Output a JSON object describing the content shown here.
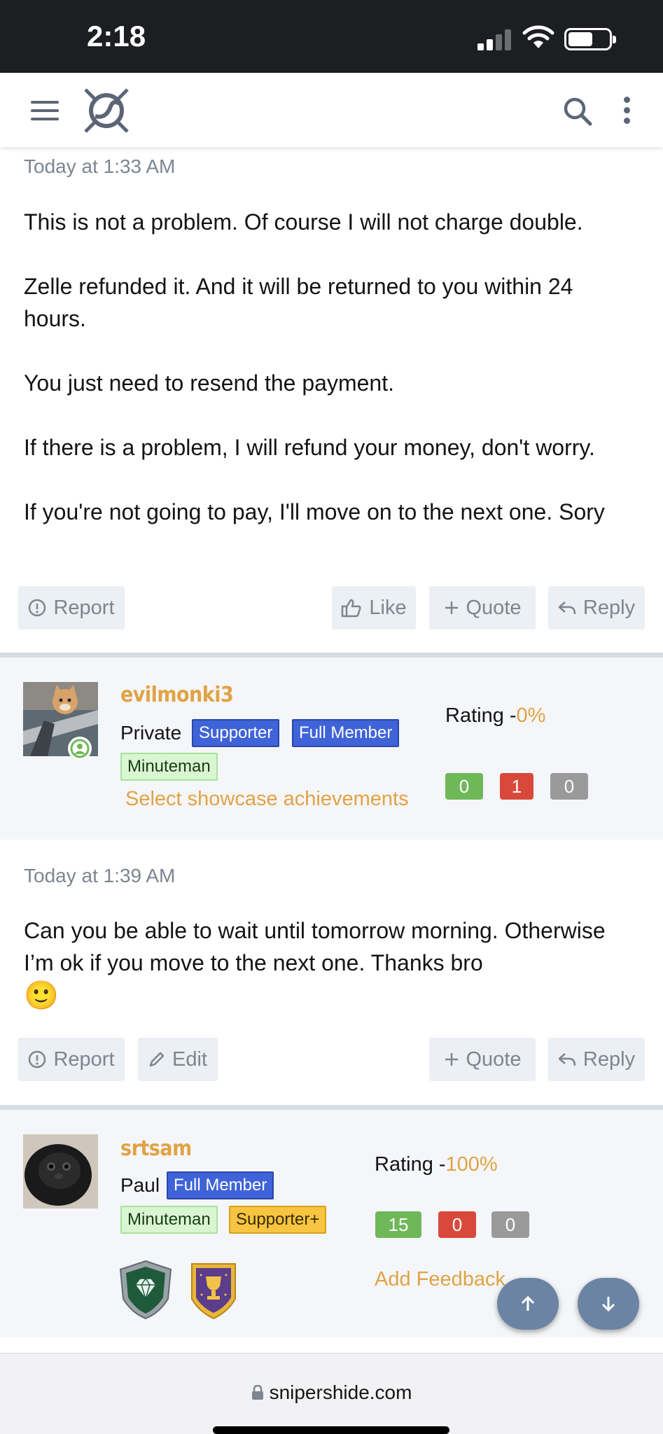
{
  "status_bar": {
    "time": "2:18"
  },
  "browser": {
    "url": "snipershide.com"
  },
  "posts": [
    {
      "timestamp": "Today at 1:33 AM",
      "paragraphs": [
        "This is not a problem. Of course I will not charge double.",
        "Zelle refunded it. And it will be returned to you within 24 hours.",
        "You just need to resend the payment.",
        "If there is a problem, I will refund your money, don't worry.",
        "If you're not going to pay, I'll move on to the next one. Sory"
      ],
      "actions": {
        "report": "Report",
        "like": "Like",
        "quote": "Quote",
        "reply": "Reply"
      }
    },
    {
      "timestamp": "Today at 1:39 AM",
      "paragraphs": [
        "Can you be able to wait until tomorrow morning. Otherwise I’m ok if you move to the next one. Thanks bro"
      ],
      "emoji": "🙂",
      "actions": {
        "report": "Report",
        "edit": "Edit",
        "quote": "Quote",
        "reply": "Reply"
      }
    }
  ],
  "authors": [
    {
      "username": "evilmonki3",
      "rank": "Private",
      "badges": [
        "Supporter",
        "Full Member",
        "Minuteman"
      ],
      "showcase_link": "Select showcase achievements",
      "rating_label": "Rating -",
      "rating_value": "0%",
      "counts": {
        "positive": "0",
        "negative": "1",
        "neutral": "0"
      }
    },
    {
      "username": "srtsam",
      "rank": "Paul",
      "badges": [
        "Full Member",
        "Minuteman",
        "Supporter+"
      ],
      "feedback_link": "Add Feedback",
      "rating_label": "Rating -",
      "rating_value": "100%",
      "counts": {
        "positive": "15",
        "negative": "0",
        "neutral": "0"
      }
    }
  ],
  "colors": {
    "accent_gold": "#e0a345",
    "badge_blue": "#3f63d8",
    "badge_green": "#d8f6d2",
    "badge_yellow": "#f7c541",
    "count_green": "#6fb85a",
    "count_red": "#d9493b",
    "count_gray": "#9a9a9a",
    "fab": "#6b84a4"
  },
  "icons": [
    "hamburger-icon",
    "site-logo-icon",
    "search-icon",
    "more-vertical-icon",
    "alert-circle-icon",
    "thumbs-up-icon",
    "plus-icon",
    "reply-arrow-icon",
    "pencil-icon",
    "online-user-icon",
    "diamond-shield-icon",
    "trophy-shield-icon",
    "arrow-up-icon",
    "arrow-down-icon",
    "lock-icon"
  ]
}
